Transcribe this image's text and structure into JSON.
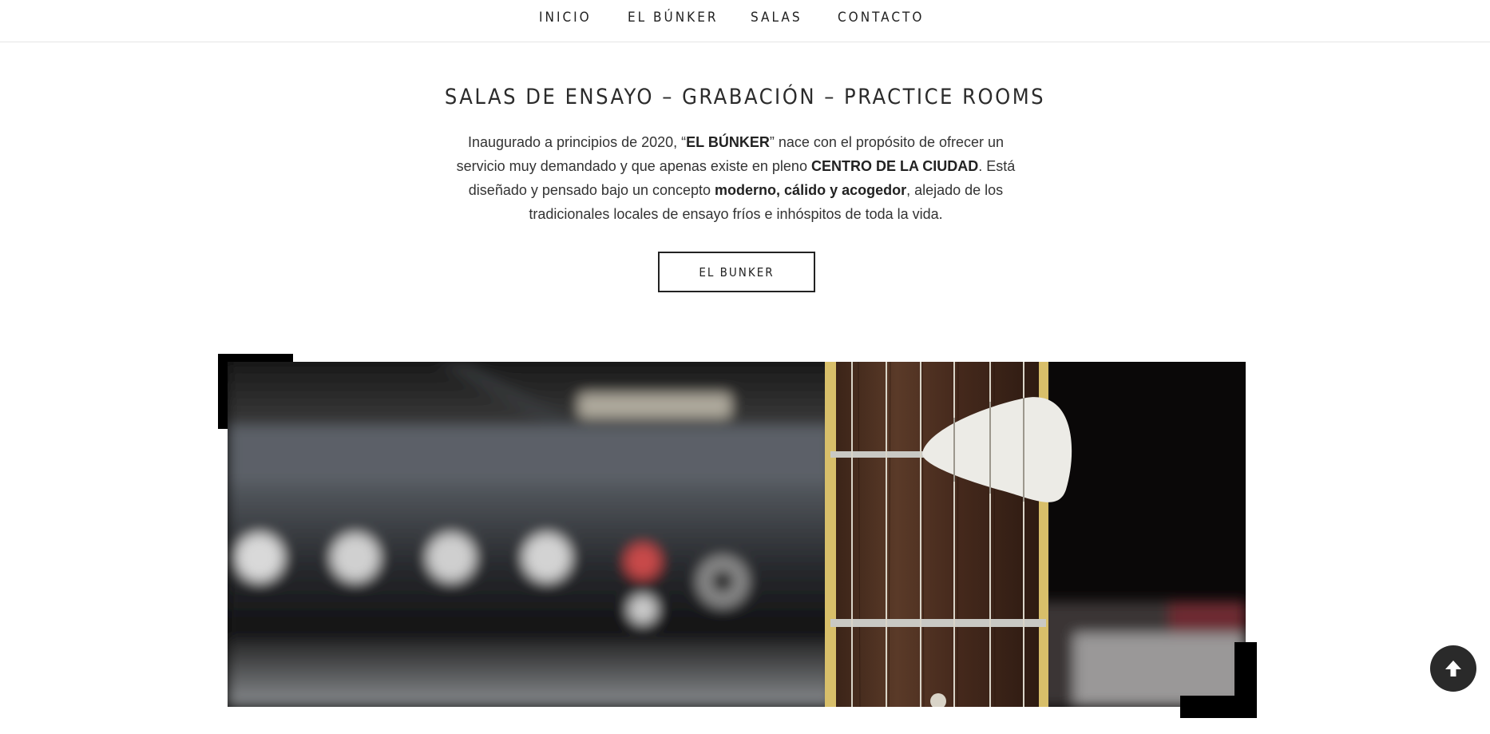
{
  "nav": {
    "items": [
      {
        "label": "INICIO"
      },
      {
        "label": "EL BÚNKER"
      },
      {
        "label": "SALAS"
      },
      {
        "label": "CONTACTO"
      }
    ]
  },
  "main": {
    "title": "SALAS DE ENSAYO – GRABACIÓN – PRACTICE ROOMS",
    "intro": {
      "t1": "Inaugurado a principios de 2020, “",
      "b1": "EL BÚNKER",
      "t2": "” nace con el propósito de ofrecer un servicio muy demandado y que apenas existe en pleno ",
      "b2": "CENTRO DE LA CIUDAD",
      "t3": ". Está diseñado y pensado bajo un concepto ",
      "b3": "moderno, cálido y acogedor",
      "t4": ", alejado de los tradicionales locales de ensayo fríos e inhóspitos de toda la vida."
    },
    "button_label": "EL BUNKER"
  },
  "photo": {
    "icon": "guitar-amplifier-photo"
  },
  "scroll_top": {
    "icon": "arrow-up-icon"
  }
}
